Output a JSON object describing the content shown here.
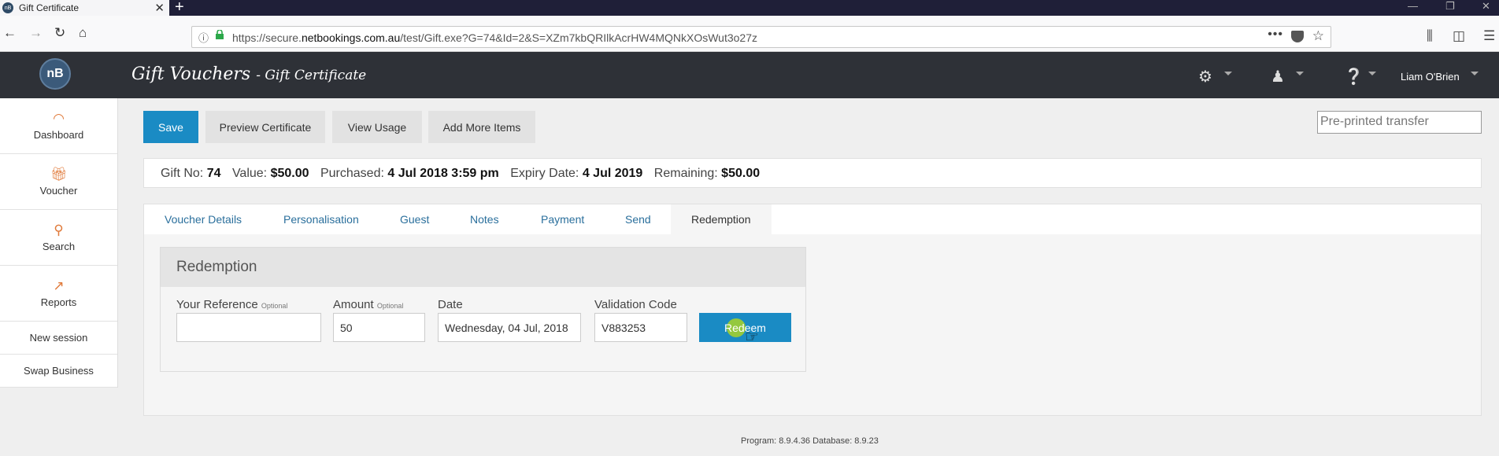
{
  "browser": {
    "tab_title": "Gift Certificate",
    "url_prefix": "https://secure.",
    "url_domain": "netbookings.com.au",
    "url_suffix": "/test/Gift.exe?G=74&Id=2&S=XZm7kbQRIlkAcrHW4MQNkXOsWut3o27z"
  },
  "header": {
    "title": "Gift Vouchers",
    "subtitle": "- Gift Certificate",
    "user_name": "Liam O'Brien"
  },
  "sidebar": {
    "items": [
      {
        "label": "Dashboard",
        "icon": "gauge-icon"
      },
      {
        "label": "Voucher",
        "icon": "gift-icon"
      },
      {
        "label": "Search",
        "icon": "search-icon"
      },
      {
        "label": "Reports",
        "icon": "chart-icon"
      }
    ],
    "links": [
      "New session",
      "Swap Business"
    ]
  },
  "toolbar": {
    "save": "Save",
    "preview": "Preview Certificate",
    "usage": "View Usage",
    "add_items": "Add More Items",
    "preprinted_placeholder": "Pre-printed transfer"
  },
  "info": {
    "gift_no_label": "Gift No:",
    "gift_no": "74",
    "value_label": "Value:",
    "value": "$50.00",
    "purchased_label": "Purchased:",
    "purchased": "4 Jul 2018 3:59 pm",
    "expiry_label": "Expiry Date:",
    "expiry": "4 Jul 2019",
    "remaining_label": "Remaining:",
    "remaining": "$50.00"
  },
  "tabs": [
    "Voucher Details",
    "Personalisation",
    "Guest",
    "Notes",
    "Payment",
    "Send",
    "Redemption"
  ],
  "active_tab": "Redemption",
  "redemption": {
    "heading": "Redemption",
    "reference_label": "Your Reference",
    "reference_hint": "Optional",
    "reference_value": "",
    "amount_label": "Amount",
    "amount_hint": "Optional",
    "amount_value": "50",
    "date_label": "Date",
    "date_value": "Wednesday, 04 Jul, 2018",
    "code_label": "Validation Code",
    "code_value": "V883253",
    "redeem_button": "Redeem"
  },
  "footer": "Program: 8.9.4.36 Database: 8.9.23",
  "colors": {
    "accent": "#1a8bc4",
    "header_bg": "#2e3137",
    "icon_orange": "#e07a3a"
  }
}
